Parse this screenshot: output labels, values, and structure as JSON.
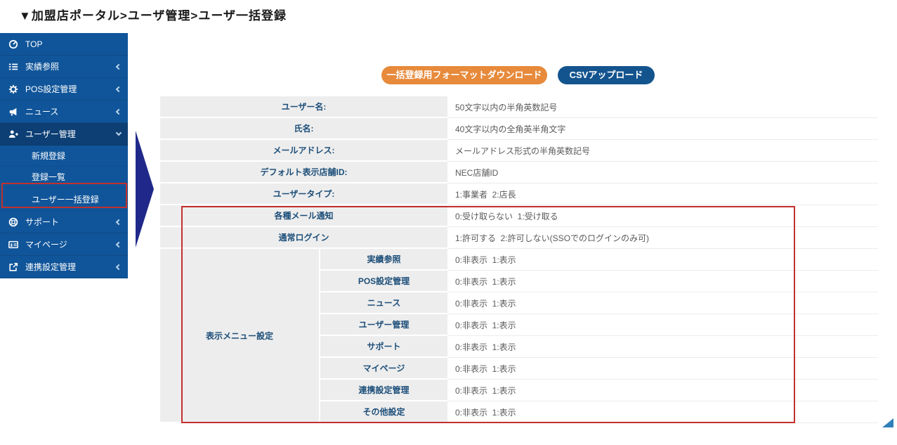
{
  "page_title": "▼加盟店ポータル>ユーザ管理>ユーザ一括登録",
  "sidebar": {
    "items_top": [
      {
        "label": "TOP",
        "icon": "dashboard-icon",
        "chevron": "none",
        "active": false
      },
      {
        "label": "実績参照",
        "icon": "list-icon",
        "chevron": "left",
        "active": false
      },
      {
        "label": "POS設定管理",
        "icon": "gear-icon",
        "chevron": "left",
        "active": false
      },
      {
        "label": "ニュース",
        "icon": "megaphone-icon",
        "chevron": "left",
        "active": false
      },
      {
        "label": "ユーザー管理",
        "icon": "user-plus-icon",
        "chevron": "down",
        "active": true
      }
    ],
    "submenu": [
      {
        "label": "新規登録",
        "highlighted": false
      },
      {
        "label": "登録一覧",
        "highlighted": false
      },
      {
        "label": "ユーザー一括登録",
        "highlighted": true
      }
    ],
    "items_bottom": [
      {
        "label": "サポート",
        "icon": "life-ring-icon",
        "chevron": "left",
        "active": false
      },
      {
        "label": "マイページ",
        "icon": "id-card-icon",
        "chevron": "left",
        "active": false
      },
      {
        "label": "連携設定管理",
        "icon": "external-link-icon",
        "chevron": "left",
        "active": false
      }
    ]
  },
  "toolbar": {
    "download_label": "一括登録用フォーマットダウンロード",
    "upload_label": "CSVアップロード"
  },
  "table": {
    "rows": [
      {
        "label": "ユーザー名:",
        "value": "50文字以内の半角英数記号"
      },
      {
        "label": "氏名:",
        "value": "40文字以内の全角英半角文字"
      },
      {
        "label": "メールアドレス:",
        "value": "メールアドレス形式の半角英数記号"
      },
      {
        "label": "デフォルト表示店舗ID:",
        "value": "NEC店舗ID"
      },
      {
        "label": "ユーザータイプ:",
        "value": "1:事業者  2:店長"
      },
      {
        "label": "各種メール通知",
        "value": "0:受け取らない  1:受け取る"
      },
      {
        "label": "通常ログイン",
        "value": "1:許可する  2:許可しない(SSOでのログインのみ可)"
      }
    ],
    "menu_group": {
      "label": "表示メニュー設定",
      "rows": [
        {
          "label": "実績参照",
          "value": "0:非表示  1:表示"
        },
        {
          "label": "POS設定管理",
          "value": "0:非表示  1:表示"
        },
        {
          "label": "ニュース",
          "value": "0:非表示  1:表示"
        },
        {
          "label": "ユーザー管理",
          "value": "0:非表示  1:表示"
        },
        {
          "label": "サポート",
          "value": "0:非表示  1:表示"
        },
        {
          "label": "マイページ",
          "value": "0:非表示  1:表示"
        },
        {
          "label": "連携設定管理",
          "value": "0:非表示  1:表示"
        },
        {
          "label": "その他設定",
          "value": "0:非表示  1:表示"
        }
      ]
    }
  },
  "colors": {
    "sidebar_bg": "#10559a",
    "sidebar_active_bg": "#0d3f75",
    "button_orange": "#e78a3b",
    "button_blue": "#14548e",
    "annotation_red": "#c2302c",
    "arrow_navy": "#20298a",
    "label_text": "#1c4e79",
    "cell_gray": "#ededed",
    "grip_blue": "#2e80b9"
  }
}
